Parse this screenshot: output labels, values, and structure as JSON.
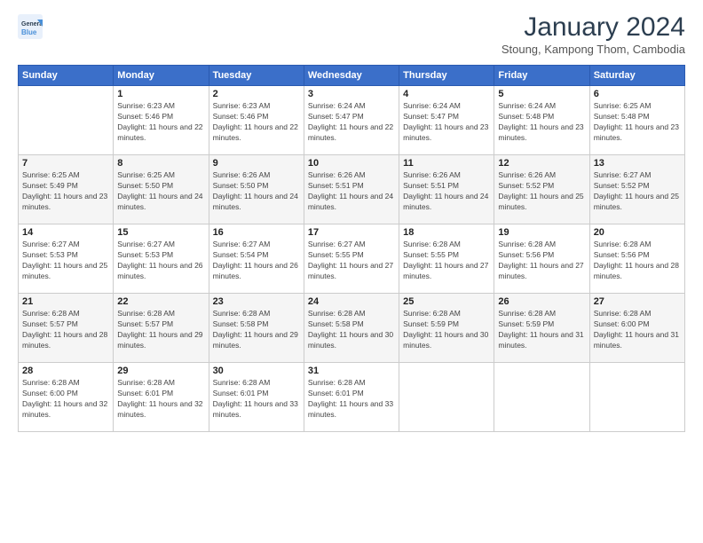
{
  "header": {
    "logo_line1": "General",
    "logo_line2": "Blue",
    "month": "January 2024",
    "location": "Stoung, Kampong Thom, Cambodia"
  },
  "weekdays": [
    "Sunday",
    "Monday",
    "Tuesday",
    "Wednesday",
    "Thursday",
    "Friday",
    "Saturday"
  ],
  "weeks": [
    [
      {
        "day": "",
        "sunrise": "",
        "sunset": "",
        "daylight": ""
      },
      {
        "day": "1",
        "sunrise": "6:23 AM",
        "sunset": "5:46 PM",
        "daylight": "11 hours and 22 minutes."
      },
      {
        "day": "2",
        "sunrise": "6:23 AM",
        "sunset": "5:46 PM",
        "daylight": "11 hours and 22 minutes."
      },
      {
        "day": "3",
        "sunrise": "6:24 AM",
        "sunset": "5:47 PM",
        "daylight": "11 hours and 22 minutes."
      },
      {
        "day": "4",
        "sunrise": "6:24 AM",
        "sunset": "5:47 PM",
        "daylight": "11 hours and 23 minutes."
      },
      {
        "day": "5",
        "sunrise": "6:24 AM",
        "sunset": "5:48 PM",
        "daylight": "11 hours and 23 minutes."
      },
      {
        "day": "6",
        "sunrise": "6:25 AM",
        "sunset": "5:48 PM",
        "daylight": "11 hours and 23 minutes."
      }
    ],
    [
      {
        "day": "7",
        "sunrise": "6:25 AM",
        "sunset": "5:49 PM",
        "daylight": "11 hours and 23 minutes."
      },
      {
        "day": "8",
        "sunrise": "6:25 AM",
        "sunset": "5:50 PM",
        "daylight": "11 hours and 24 minutes."
      },
      {
        "day": "9",
        "sunrise": "6:26 AM",
        "sunset": "5:50 PM",
        "daylight": "11 hours and 24 minutes."
      },
      {
        "day": "10",
        "sunrise": "6:26 AM",
        "sunset": "5:51 PM",
        "daylight": "11 hours and 24 minutes."
      },
      {
        "day": "11",
        "sunrise": "6:26 AM",
        "sunset": "5:51 PM",
        "daylight": "11 hours and 24 minutes."
      },
      {
        "day": "12",
        "sunrise": "6:26 AM",
        "sunset": "5:52 PM",
        "daylight": "11 hours and 25 minutes."
      },
      {
        "day": "13",
        "sunrise": "6:27 AM",
        "sunset": "5:52 PM",
        "daylight": "11 hours and 25 minutes."
      }
    ],
    [
      {
        "day": "14",
        "sunrise": "6:27 AM",
        "sunset": "5:53 PM",
        "daylight": "11 hours and 25 minutes."
      },
      {
        "day": "15",
        "sunrise": "6:27 AM",
        "sunset": "5:53 PM",
        "daylight": "11 hours and 26 minutes."
      },
      {
        "day": "16",
        "sunrise": "6:27 AM",
        "sunset": "5:54 PM",
        "daylight": "11 hours and 26 minutes."
      },
      {
        "day": "17",
        "sunrise": "6:27 AM",
        "sunset": "5:55 PM",
        "daylight": "11 hours and 27 minutes."
      },
      {
        "day": "18",
        "sunrise": "6:28 AM",
        "sunset": "5:55 PM",
        "daylight": "11 hours and 27 minutes."
      },
      {
        "day": "19",
        "sunrise": "6:28 AM",
        "sunset": "5:56 PM",
        "daylight": "11 hours and 27 minutes."
      },
      {
        "day": "20",
        "sunrise": "6:28 AM",
        "sunset": "5:56 PM",
        "daylight": "11 hours and 28 minutes."
      }
    ],
    [
      {
        "day": "21",
        "sunrise": "6:28 AM",
        "sunset": "5:57 PM",
        "daylight": "11 hours and 28 minutes."
      },
      {
        "day": "22",
        "sunrise": "6:28 AM",
        "sunset": "5:57 PM",
        "daylight": "11 hours and 29 minutes."
      },
      {
        "day": "23",
        "sunrise": "6:28 AM",
        "sunset": "5:58 PM",
        "daylight": "11 hours and 29 minutes."
      },
      {
        "day": "24",
        "sunrise": "6:28 AM",
        "sunset": "5:58 PM",
        "daylight": "11 hours and 30 minutes."
      },
      {
        "day": "25",
        "sunrise": "6:28 AM",
        "sunset": "5:59 PM",
        "daylight": "11 hours and 30 minutes."
      },
      {
        "day": "26",
        "sunrise": "6:28 AM",
        "sunset": "5:59 PM",
        "daylight": "11 hours and 31 minutes."
      },
      {
        "day": "27",
        "sunrise": "6:28 AM",
        "sunset": "6:00 PM",
        "daylight": "11 hours and 31 minutes."
      }
    ],
    [
      {
        "day": "28",
        "sunrise": "6:28 AM",
        "sunset": "6:00 PM",
        "daylight": "11 hours and 32 minutes."
      },
      {
        "day": "29",
        "sunrise": "6:28 AM",
        "sunset": "6:01 PM",
        "daylight": "11 hours and 32 minutes."
      },
      {
        "day": "30",
        "sunrise": "6:28 AM",
        "sunset": "6:01 PM",
        "daylight": "11 hours and 33 minutes."
      },
      {
        "day": "31",
        "sunrise": "6:28 AM",
        "sunset": "6:01 PM",
        "daylight": "11 hours and 33 minutes."
      },
      {
        "day": "",
        "sunrise": "",
        "sunset": "",
        "daylight": ""
      },
      {
        "day": "",
        "sunrise": "",
        "sunset": "",
        "daylight": ""
      },
      {
        "day": "",
        "sunrise": "",
        "sunset": "",
        "daylight": ""
      }
    ]
  ]
}
